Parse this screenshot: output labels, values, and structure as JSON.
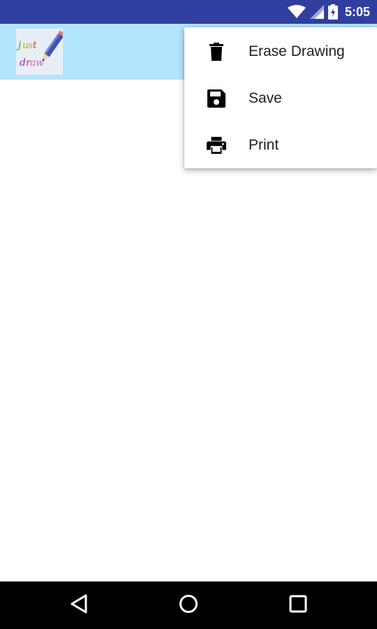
{
  "status_bar": {
    "time": "5:05",
    "icons": [
      "wifi-icon",
      "cell-signal-icon",
      "battery-charging-icon"
    ],
    "background": "#303f9f"
  },
  "app_bar": {
    "logo_lines": [
      "just",
      "draw"
    ],
    "background": "#b3e5fc"
  },
  "menu": {
    "items": [
      {
        "label": "Erase Drawing",
        "icon": "trash-icon"
      },
      {
        "label": "Save",
        "icon": "save-icon"
      },
      {
        "label": "Print",
        "icon": "print-icon"
      }
    ]
  },
  "nav_bar": {
    "buttons": [
      "back-icon",
      "home-icon",
      "recents-icon"
    ],
    "background": "#000000"
  }
}
